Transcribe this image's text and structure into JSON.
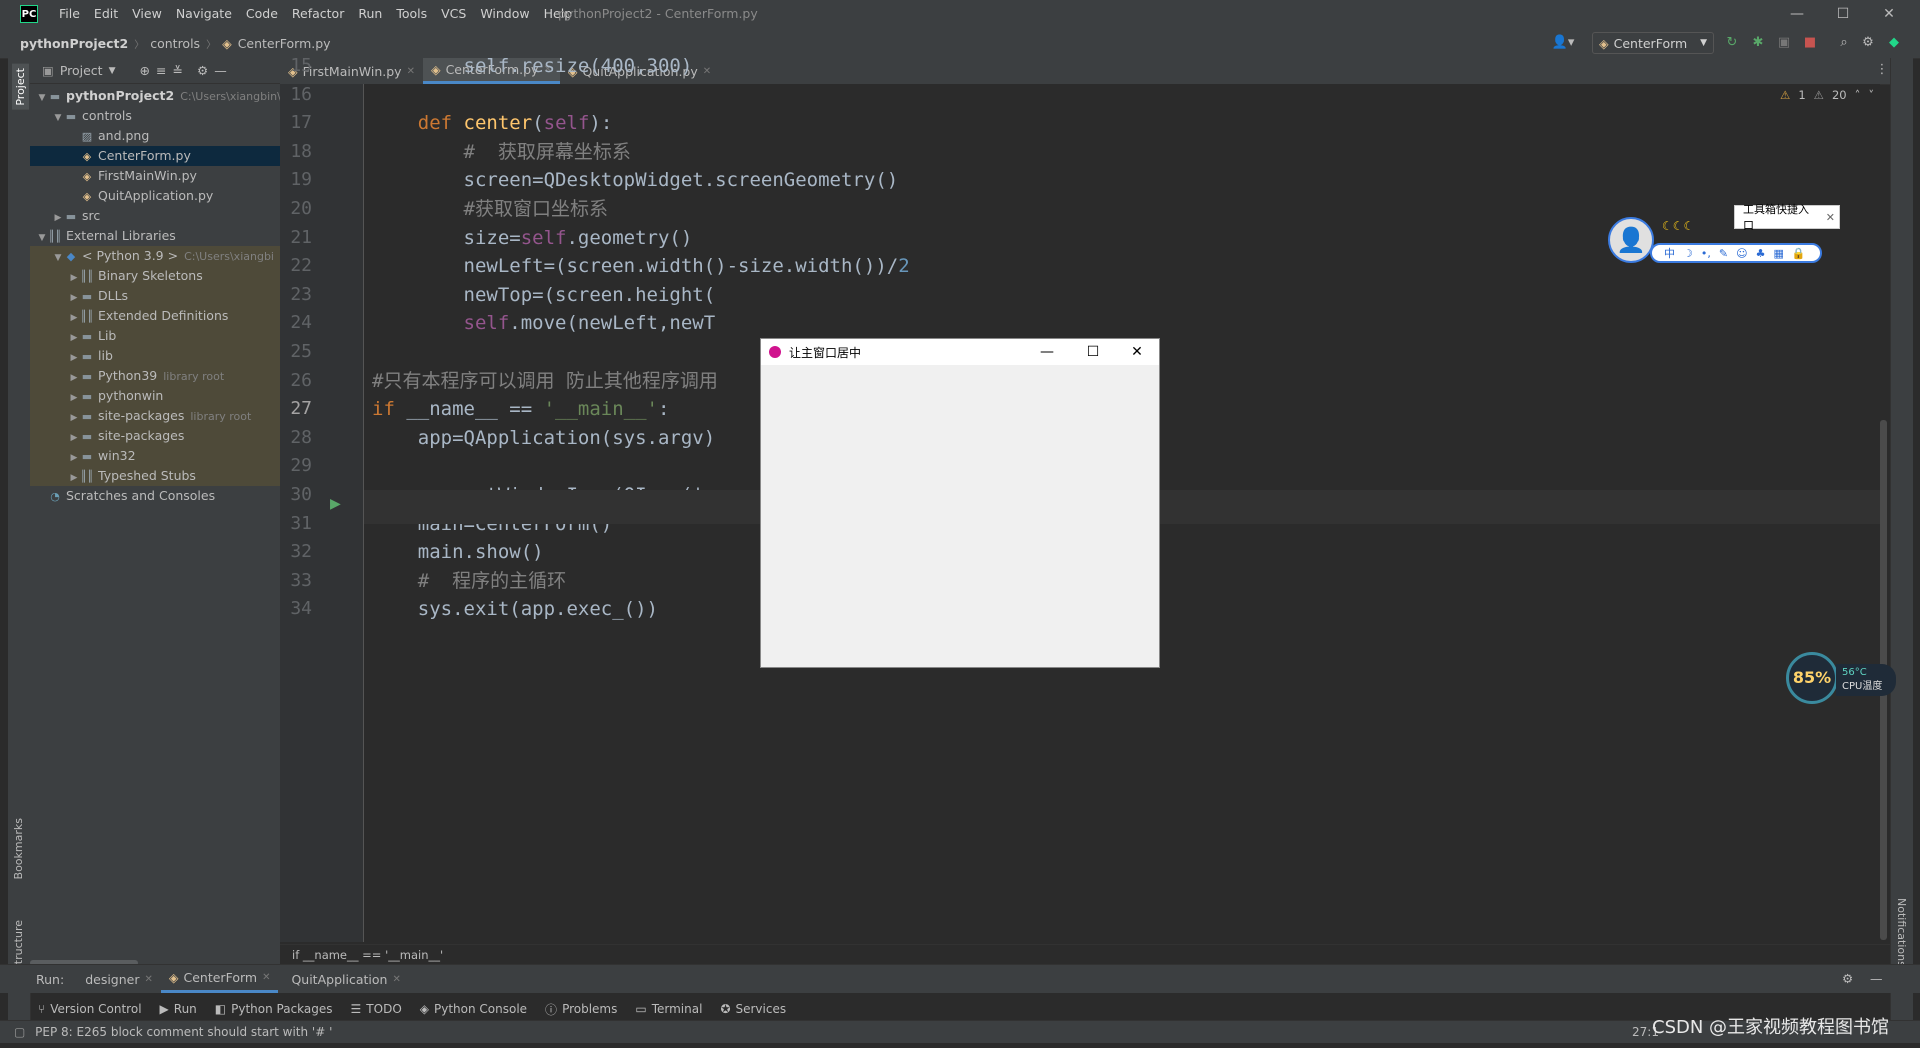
{
  "window": {
    "title": "pythonProject2 - CenterForm.py",
    "menu": [
      "File",
      "Edit",
      "View",
      "Navigate",
      "Code",
      "Refactor",
      "Run",
      "Tools",
      "VCS",
      "Window",
      "Help"
    ]
  },
  "navbar": {
    "project": "pythonProject2",
    "folder": "controls",
    "file": "CenterForm.py",
    "run_config": "CenterForm"
  },
  "project_panel": {
    "header": "Project",
    "tree": [
      {
        "label": "pythonProject2",
        "hint": "C:\\Users\\xiangbin\\",
        "indent": 0,
        "arrow": "▼",
        "icon": "folder-icon"
      },
      {
        "label": "controls",
        "hint": "",
        "indent": 1,
        "arrow": "▼",
        "icon": "folder-icon"
      },
      {
        "label": "and.png",
        "hint": "",
        "indent": 2,
        "arrow": "",
        "icon": "image-file-icon"
      },
      {
        "label": "CenterForm.py",
        "hint": "",
        "indent": 2,
        "arrow": "",
        "icon": "python-file-icon",
        "selected": true
      },
      {
        "label": "FirstMainWin.py",
        "hint": "",
        "indent": 2,
        "arrow": "",
        "icon": "python-file-icon"
      },
      {
        "label": "QuitApplication.py",
        "hint": "",
        "indent": 2,
        "arrow": "",
        "icon": "python-file-icon"
      },
      {
        "label": "src",
        "hint": "",
        "indent": 1,
        "arrow": "▶",
        "icon": "folder-icon"
      },
      {
        "label": "External Libraries",
        "hint": "",
        "indent": 0,
        "arrow": "▼",
        "icon": "library-icon"
      },
      {
        "label": "< Python 3.9 >",
        "hint": "C:\\Users\\xiangbi",
        "indent": 1,
        "arrow": "▼",
        "icon": "python-sdk-icon",
        "lib": true
      },
      {
        "label": "Binary Skeletons",
        "hint": "",
        "indent": 2,
        "arrow": "▶",
        "icon": "library-icon",
        "lib": true
      },
      {
        "label": "DLLs",
        "hint": "",
        "indent": 2,
        "arrow": "▶",
        "icon": "folder-icon",
        "lib": true
      },
      {
        "label": "Extended Definitions",
        "hint": "",
        "indent": 2,
        "arrow": "▶",
        "icon": "library-icon",
        "lib": true
      },
      {
        "label": "Lib",
        "hint": "",
        "indent": 2,
        "arrow": "▶",
        "icon": "folder-icon",
        "lib": true
      },
      {
        "label": "lib",
        "hint": "",
        "indent": 2,
        "arrow": "▶",
        "icon": "folder-icon",
        "lib": true
      },
      {
        "label": "Python39",
        "hint": "library root",
        "indent": 2,
        "arrow": "▶",
        "icon": "folder-icon",
        "lib": true
      },
      {
        "label": "pythonwin",
        "hint": "",
        "indent": 2,
        "arrow": "▶",
        "icon": "folder-icon",
        "lib": true
      },
      {
        "label": "site-packages",
        "hint": "library root",
        "indent": 2,
        "arrow": "▶",
        "icon": "folder-icon",
        "lib": true
      },
      {
        "label": "site-packages",
        "hint": "",
        "indent": 2,
        "arrow": "▶",
        "icon": "folder-icon",
        "lib": true
      },
      {
        "label": "win32",
        "hint": "",
        "indent": 2,
        "arrow": "▶",
        "icon": "folder-icon",
        "lib": true
      },
      {
        "label": "Typeshed Stubs",
        "hint": "",
        "indent": 2,
        "arrow": "▶",
        "icon": "library-icon",
        "lib": true
      },
      {
        "label": "Scratches and Consoles",
        "hint": "",
        "indent": 0,
        "arrow": "",
        "icon": "scratches-icon"
      }
    ]
  },
  "editor": {
    "tabs": [
      {
        "label": "FirstMainWin.py",
        "active": false
      },
      {
        "label": "CenterForm.py",
        "active": true
      },
      {
        "label": "QuitApplication.py",
        "active": false
      }
    ],
    "inspections": {
      "warnings": "1",
      "weak_warnings": "20"
    },
    "breadcrumb": "if __name__ == '__main__'",
    "lines": [
      {
        "num": "15",
        "html": "        self.resize(400,300)"
      },
      {
        "num": "16",
        "html": ""
      },
      {
        "num": "17",
        "html": "    <span class='kw'>def</span> <span class='fn'>center</span>(<span class='sf'>self</span>):"
      },
      {
        "num": "18",
        "html": "        <span class='cm'>#  获取屏幕坐标系</span>"
      },
      {
        "num": "19",
        "html": "        screen=QDesktopWidget.screenGeometry()"
      },
      {
        "num": "20",
        "html": "        <span class='cm'>#获取窗口坐标系</span>"
      },
      {
        "num": "21",
        "html": "        size=<span class='sf'>self</span>.geometry()"
      },
      {
        "num": "22",
        "html": "        newLeft=(screen.width()-size.width())/<span class='nm'>2</span>"
      },
      {
        "num": "23",
        "html": "        newTop=(screen.height("
      },
      {
        "num": "24",
        "html": "        <span class='sf'>self</span>.move(newLeft,newT"
      },
      {
        "num": "25",
        "html": ""
      },
      {
        "num": "26",
        "html": "<span class='cm'>#只有本程序可以调用 防止其他程序调用</span>"
      },
      {
        "num": "27",
        "html": "<span class='kw'>if</span> __name__ == <span class='st'>'__main__'</span>:"
      },
      {
        "num": "28",
        "html": "    app=QApplication(sys.argv)"
      },
      {
        "num": "29",
        "html": ""
      },
      {
        "num": "30",
        "html": "    app.setWindowIcon(QIcon('."
      },
      {
        "num": "31",
        "html": "    main=CenterForm()"
      },
      {
        "num": "32",
        "html": "    main.show()"
      },
      {
        "num": "33",
        "html": "    <span class='cm'>#  程序的主循环</span>"
      },
      {
        "num": "34",
        "html": "    sys.exit(app.exec_())"
      }
    ]
  },
  "dialog": {
    "title": "让主窗口居中"
  },
  "run_panel": {
    "label": "Run:",
    "tabs": [
      {
        "label": "designer",
        "active": false
      },
      {
        "label": "CenterForm",
        "active": true
      },
      {
        "label": "QuitApplication",
        "active": false
      }
    ]
  },
  "tool_windows": [
    {
      "label": "Version Control",
      "icon": "version-control-icon"
    },
    {
      "label": "Run",
      "icon": "run-icon",
      "active": true
    },
    {
      "label": "Python Packages",
      "icon": "packages-icon"
    },
    {
      "label": "TODO",
      "icon": "todo-icon"
    },
    {
      "label": "Python Console",
      "icon": "python-console-icon"
    },
    {
      "label": "Problems",
      "icon": "problems-icon"
    },
    {
      "label": "Terminal",
      "icon": "terminal-icon"
    },
    {
      "label": "Services",
      "icon": "services-icon"
    }
  ],
  "status": {
    "message": "PEP 8: E265 block comment should start with '# '",
    "position": "27:1",
    "watermark": "CSDN @王家视频教程图书馆"
  },
  "side_labels": {
    "project": "Project",
    "bookmarks": "Bookmarks",
    "structure": "Structure",
    "notifications": "Notifications"
  },
  "toolbox_widget": {
    "label": "工具箱快捷入口"
  },
  "cpu_widget": {
    "load": "85%",
    "temp": "56°C",
    "label": "CPU温度"
  },
  "colors": {
    "accent": "#4a88c7",
    "keyword": "#cc7832",
    "function": "#ffc66d",
    "self": "#94558d",
    "comment": "#808080",
    "string": "#6a8759",
    "number": "#6897bb"
  }
}
